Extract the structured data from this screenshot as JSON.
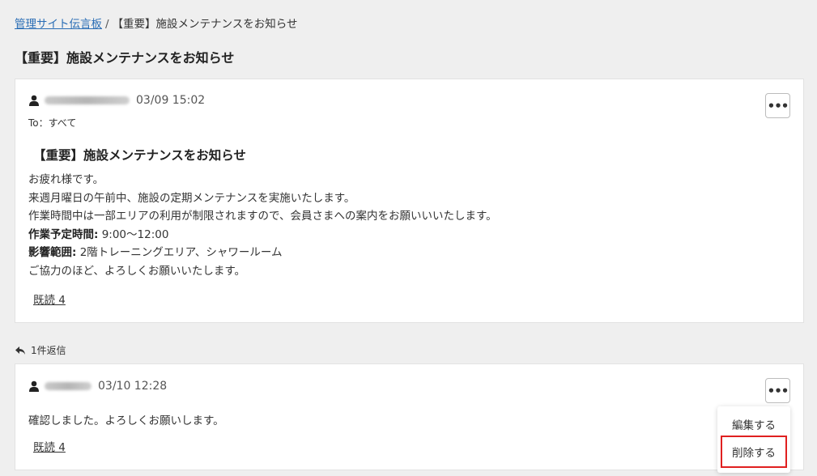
{
  "breadcrumb": {
    "parent": "管理サイト伝言板",
    "separator": "/",
    "current": "【重要】施設メンテナンスをお知らせ"
  },
  "page_title": "【重要】施設メンテナンスをお知らせ",
  "post": {
    "timestamp": "03/09 15:02",
    "to": "To：すべて",
    "title": "【重要】施設メンテナンスをお知らせ",
    "lines": [
      "お疲れ様です。",
      "来週月曜日の午前中、施設の定期メンテナンスを実施いたします。",
      "作業時間中は一部エリアの利用が制限されますので、会員さまへの案内をお願いいいたします。"
    ],
    "schedule_label": "作業予定時間:",
    "schedule_value": " 9:00〜12:00",
    "scope_label": "影響範囲:",
    "scope_value": " 2階トレーニングエリア、シャワールーム",
    "closing": "ご協力のほど、よろしくお願いいたします。",
    "read_label": "既読 4"
  },
  "reply_count": "1件返信",
  "reply": {
    "timestamp": "03/10 12:28",
    "text": "確認しました。よろしくお願いします。",
    "read_label": "既読 4"
  },
  "menu": {
    "edit": "編集する",
    "delete": "削除する"
  },
  "colors": {
    "link": "#2a6db5",
    "highlight": "#e02020",
    "background": "#efefef"
  },
  "icons": [
    "user-icon",
    "more-icon",
    "reply-icon"
  ]
}
